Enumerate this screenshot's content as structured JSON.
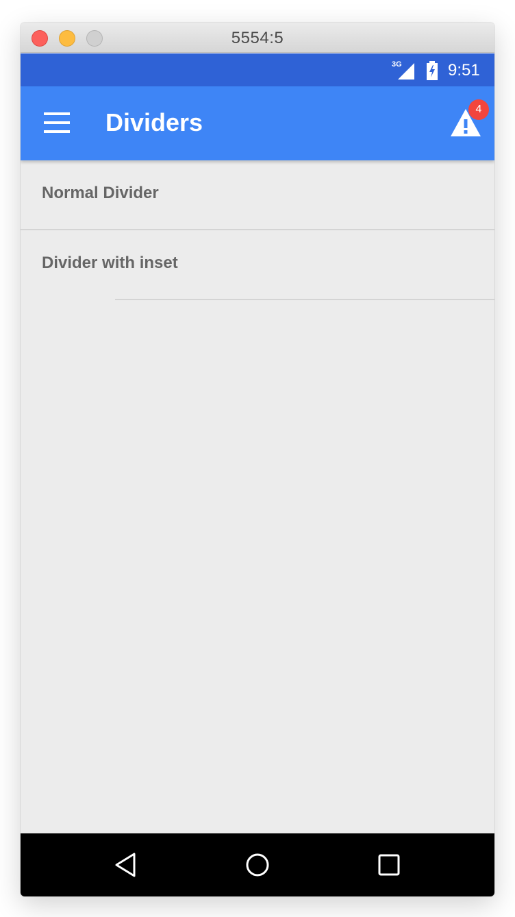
{
  "window": {
    "title": "5554:5"
  },
  "status_bar": {
    "network": "3G",
    "time": "9:51"
  },
  "app_bar": {
    "title": "Dividers",
    "menu_icon": "menu-icon",
    "alert_icon": "warning-icon",
    "alert_badge": "4"
  },
  "list": {
    "items": [
      {
        "label": "Normal Divider",
        "divider": "full"
      },
      {
        "label": "Divider with inset",
        "divider": "inset"
      }
    ]
  },
  "nav_bar": {
    "back_icon": "back-icon",
    "home_icon": "home-icon",
    "recents_icon": "recents-icon"
  },
  "colors": {
    "status_bar": "#2f62d6",
    "app_bar": "#3e85f6",
    "badge": "#f2453d",
    "background": "#ececec"
  }
}
